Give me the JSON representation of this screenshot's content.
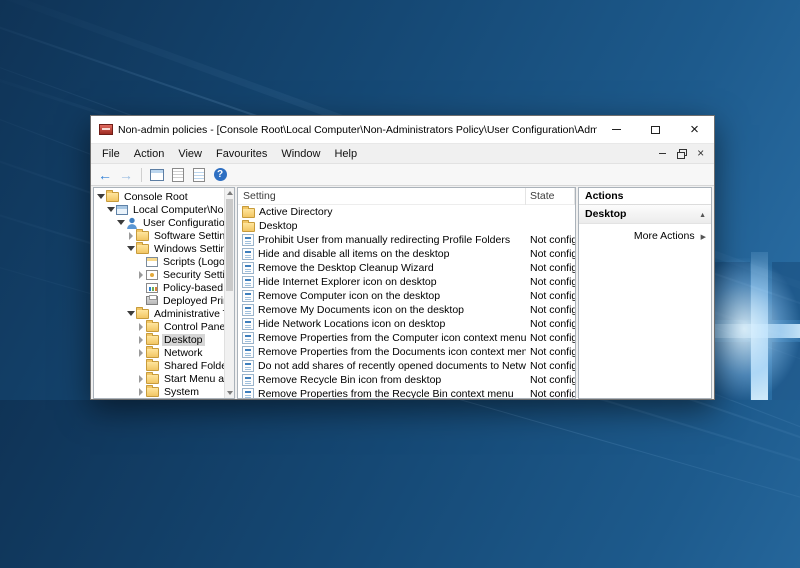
{
  "window": {
    "title": "Non-admin policies - [Console Root\\Local Computer\\Non-Administrators Policy\\User Configuration\\Administrative Templ",
    "caption_buttons": [
      "minimize",
      "maximize",
      "close"
    ]
  },
  "menu": {
    "items": [
      "File",
      "Action",
      "View",
      "Favourites",
      "Window",
      "Help"
    ]
  },
  "toolbar": {
    "items": [
      "back",
      "forward",
      "sep",
      "console-tree",
      "properties",
      "export-list",
      "help"
    ]
  },
  "tree": {
    "items": [
      {
        "label": "Console Root",
        "level": 0,
        "expander": "expanded",
        "icon": "folder",
        "selected": false
      },
      {
        "label": "Local Computer\\Non-Adm",
        "level": 1,
        "expander": "expanded",
        "icon": "computer",
        "selected": false
      },
      {
        "label": "User Configuration",
        "level": 2,
        "expander": "expanded",
        "icon": "user",
        "selected": false
      },
      {
        "label": "Software Settings",
        "level": 3,
        "expander": "collapsed",
        "icon": "folder",
        "selected": false
      },
      {
        "label": "Windows Settings",
        "level": 3,
        "expander": "expanded",
        "icon": "folder",
        "selected": false
      },
      {
        "label": "Scripts (Logon/",
        "level": 4,
        "expander": "none",
        "icon": "scripts",
        "selected": false
      },
      {
        "label": "Security Setting",
        "level": 4,
        "expander": "collapsed",
        "icon": "security",
        "selected": false
      },
      {
        "label": "Policy-based Q",
        "level": 4,
        "expander": "none",
        "icon": "qos",
        "selected": false
      },
      {
        "label": "Deployed Printe",
        "level": 4,
        "expander": "none",
        "icon": "printer",
        "selected": false
      },
      {
        "label": "Administrative Temp",
        "level": 3,
        "expander": "expanded",
        "icon": "folder",
        "selected": false
      },
      {
        "label": "Control Panel",
        "level": 4,
        "expander": "collapsed",
        "icon": "folder",
        "selected": false
      },
      {
        "label": "Desktop",
        "level": 4,
        "expander": "collapsed",
        "icon": "folder",
        "selected": true
      },
      {
        "label": "Network",
        "level": 4,
        "expander": "collapsed",
        "icon": "folder",
        "selected": false
      },
      {
        "label": "Shared Folders",
        "level": 4,
        "expander": "none",
        "icon": "folder",
        "selected": false
      },
      {
        "label": "Start Menu and",
        "level": 4,
        "expander": "collapsed",
        "icon": "folder",
        "selected": false
      },
      {
        "label": "System",
        "level": 4,
        "expander": "collapsed",
        "icon": "folder",
        "selected": false
      }
    ]
  },
  "list": {
    "columns": [
      "Setting",
      "State"
    ],
    "rows": [
      {
        "label": "Active Directory",
        "icon": "folder",
        "state": ""
      },
      {
        "label": "Desktop",
        "icon": "folder",
        "state": ""
      },
      {
        "label": "Prohibit User from manually redirecting Profile Folders",
        "icon": "policy",
        "state": "Not configu"
      },
      {
        "label": "Hide and disable all items on the desktop",
        "icon": "policy",
        "state": "Not configu"
      },
      {
        "label": "Remove the Desktop Cleanup Wizard",
        "icon": "policy",
        "state": "Not configu"
      },
      {
        "label": "Hide Internet Explorer icon on desktop",
        "icon": "policy",
        "state": "Not configu"
      },
      {
        "label": "Remove Computer icon on the desktop",
        "icon": "policy",
        "state": "Not configu"
      },
      {
        "label": "Remove My Documents icon on the desktop",
        "icon": "policy",
        "state": "Not configu"
      },
      {
        "label": "Hide Network Locations icon on desktop",
        "icon": "policy",
        "state": "Not configu"
      },
      {
        "label": "Remove Properties from the Computer icon context menu",
        "icon": "policy",
        "state": "Not configu"
      },
      {
        "label": "Remove Properties from the Documents icon context menu",
        "icon": "policy",
        "state": "Not configu"
      },
      {
        "label": "Do not add shares of recently opened documents to Networ...",
        "icon": "policy",
        "state": "Not configu"
      },
      {
        "label": "Remove Recycle Bin icon from desktop",
        "icon": "policy",
        "state": "Not configu"
      },
      {
        "label": "Remove Properties from the Recycle Bin context menu",
        "icon": "policy",
        "state": "Not configu"
      }
    ]
  },
  "actions": {
    "title": "Actions",
    "group": "Desktop",
    "more_actions": "More Actions"
  },
  "colors": {
    "selection": "#d6d6d6",
    "accent_blue": "#2f7fd6",
    "folder_yellow": "#f2c664",
    "wallpaper_blue": "#1d5a8c"
  }
}
